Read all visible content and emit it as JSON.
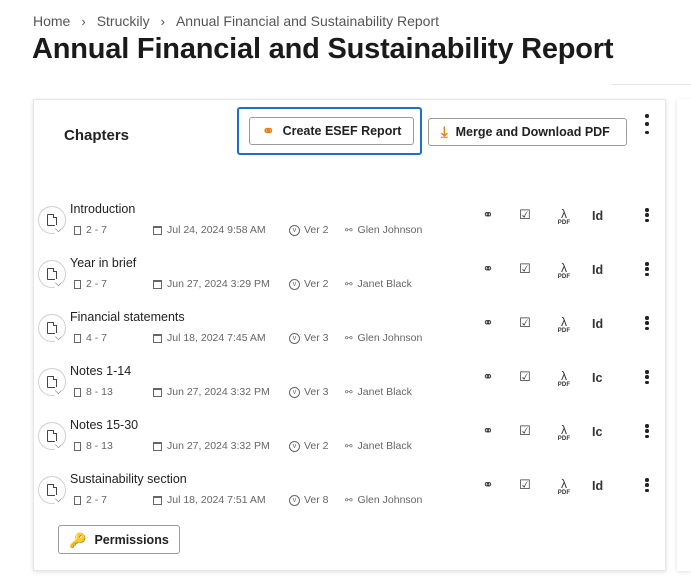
{
  "breadcrumb": {
    "items": [
      "Home",
      "Struckily",
      "Annual Financial and Sustainability Report"
    ],
    "separator": "›"
  },
  "page": {
    "title": "Annual Financial and Sustainability Report"
  },
  "card": {
    "title": "Chapters",
    "create_esef_label": "Create ESEF Report",
    "merge_pdf_label": "Merge and Download PDF",
    "permissions_label": "Permissions"
  },
  "chapters": [
    {
      "name": "Introduction",
      "pages": "2 - 7",
      "date": "Jul 24, 2024 9:58 AM",
      "version": "Ver 2",
      "user": "Glen Johnson",
      "action_label": "Id"
    },
    {
      "name": "Year in brief",
      "pages": "2 - 7",
      "date": "Jun 27, 2024 3:29 PM",
      "version": "Ver 2",
      "user": "Janet Black",
      "action_label": "Id"
    },
    {
      "name": "Financial statements",
      "pages": "4 - 7",
      "date": "Jul 18, 2024 7:45 AM",
      "version": "Ver 3",
      "user": "Glen Johnson",
      "action_label": "Id"
    },
    {
      "name": "Notes 1-14",
      "pages": "8 - 13",
      "date": "Jun 27, 2024 3:32 PM",
      "version": "Ver 3",
      "user": "Janet Black",
      "action_label": "Ic"
    },
    {
      "name": "Notes 15-30",
      "pages": "8 - 13",
      "date": "Jun 27, 2024 3:32 PM",
      "version": "Ver 2",
      "user": "Janet Black",
      "action_label": "Ic"
    },
    {
      "name": "Sustainability section",
      "pages": "2 - 7",
      "date": "Jul 18, 2024 7:51 AM",
      "version": "Ver 8",
      "user": "Glen Johnson",
      "action_label": "Id"
    }
  ],
  "icons": {
    "esef": "esef-report-icon",
    "merge": "download-icon",
    "permissions": "key-icon",
    "pdf_badge": "PDF"
  },
  "colors": {
    "accent": "#e8821b",
    "focus": "#1d6fc7"
  }
}
